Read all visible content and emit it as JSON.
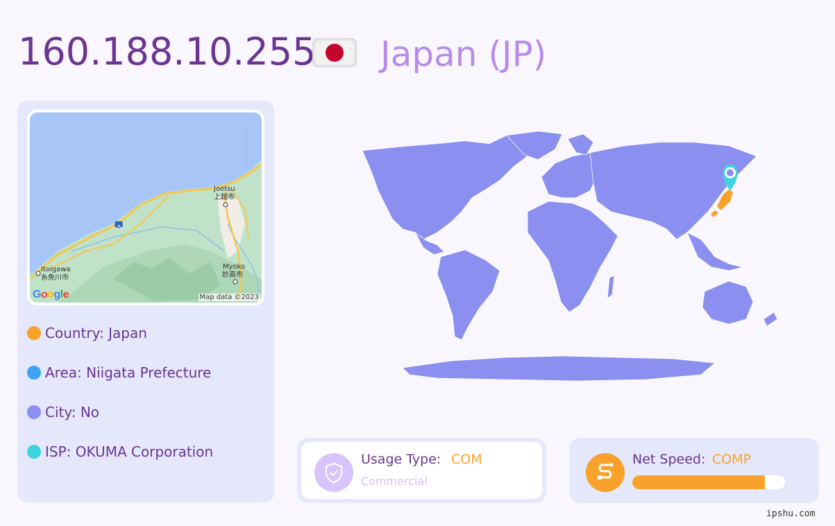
{
  "header": {
    "ip": "160.188.10.255",
    "country_title": "Japan (JP)",
    "flag_icon": "japan-flag-icon"
  },
  "map": {
    "labels": {
      "joetsu_en": "Joetsu",
      "joetsu_jp": "上越市",
      "itoigawa_en": "Itoigawa",
      "itoigawa_jp": "糸魚川市",
      "myoko_en": "Myoko",
      "myoko_jp": "妙高市",
      "route": "8"
    },
    "logo": "Google",
    "attribution": "Map data ©2023"
  },
  "info": {
    "country": "Country: Japan",
    "area": "Area: Niigata Prefecture",
    "city": "City: No",
    "isp": "ISP: OKUMA Corporation",
    "colors": {
      "country": "#f8a12b",
      "area": "#3fa3f1",
      "city": "#8a8ff0",
      "isp": "#3fd3df"
    }
  },
  "usage": {
    "label": "Usage Type:",
    "value": "COM",
    "sub": "Commercial",
    "icon": "shield-check-icon"
  },
  "speed": {
    "label": "Net Speed:",
    "value": "COMP",
    "icon": "route-icon",
    "fill_fraction": 0.87
  },
  "watermark": "ipshu.com",
  "colors": {
    "primary": "#6b3591",
    "accent": "#b98be9",
    "orange": "#f8a12b",
    "panel": "#e4e8fa",
    "land": "#8a8ff0",
    "highlight_country": "#f8a12b",
    "marker": "#3fd3df"
  }
}
